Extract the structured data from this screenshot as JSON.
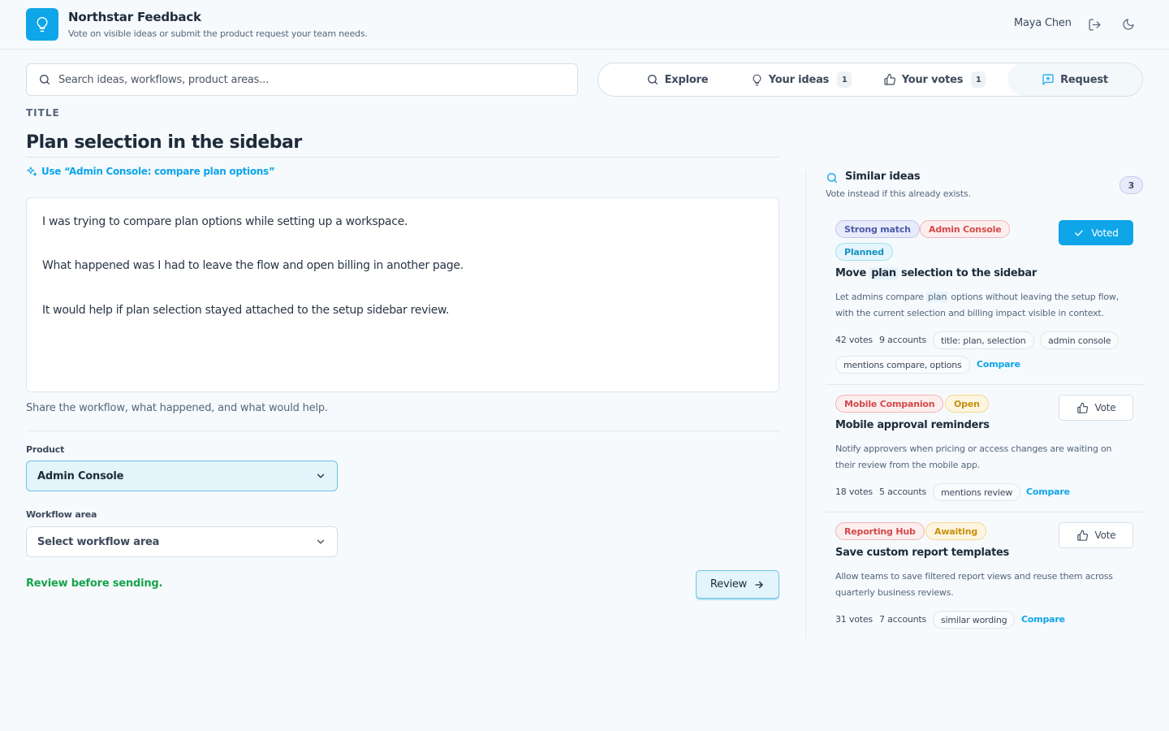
{
  "app": {
    "title": "Northstar Feedback",
    "subtitle": "Vote on visible ideas or submit the product request your team needs.",
    "user_name": "Maya Chen",
    "icons": [
      "lightbulb-icon",
      "logout-icon",
      "moon-icon"
    ]
  },
  "search": {
    "placeholder": "Search ideas, workflows, product areas...",
    "value": ""
  },
  "nav": {
    "explore": "Explore",
    "your_ideas": "Your ideas",
    "your_ideas_count": "1",
    "your_votes": "Your votes",
    "your_votes_count": "1",
    "request": "Request",
    "active": "request"
  },
  "form": {
    "title_label": "TITLE",
    "title_value": "Plan selection in the sidebar",
    "suggestion": "Use “Admin Console: compare plan options”",
    "description_lines": [
      "I was trying to compare plan options while setting up a workspace.",
      "What happened was I had to leave the flow and open billing in another page.",
      "It would help if plan selection stayed attached to the setup sidebar review."
    ],
    "hint": "Share the workflow, what happened, and what would help.",
    "product_label": "Product",
    "product_value": "Admin Console",
    "workflow_label": "Workflow area",
    "workflow_placeholder": "Select workflow area",
    "review_note": "Review before sending.",
    "review_button": "Review"
  },
  "similar": {
    "title": "Similar ideas",
    "subtitle": "Vote instead if this already exists.",
    "count": "3",
    "ideas": [
      {
        "tags": [
          "Strong match",
          "Admin Console",
          "Planned"
        ],
        "title_parts": [
          "Move ",
          "plan",
          " selection to the sidebar"
        ],
        "desc_parts": [
          "Let admins compare ",
          "plan",
          " options without leaving the setup flow, with the current selection and billing impact visible in context."
        ],
        "votes": "42 votes",
        "accounts": "9 accounts",
        "chips": [
          "title: plan, selection",
          "admin console",
          "mentions compare, options"
        ],
        "compare": "Compare",
        "vote_label": "Voted",
        "voted": true
      },
      {
        "tags": [
          "Mobile Companion",
          "Open"
        ],
        "title": "Mobile approval reminders",
        "desc": "Notify approvers when pricing or access changes are waiting on their review from the mobile app.",
        "votes": "18 votes",
        "accounts": "5 accounts",
        "chips": [
          "mentions review"
        ],
        "compare": "Compare",
        "vote_label": "Vote",
        "voted": false
      },
      {
        "tags": [
          "Reporting Hub",
          "Awaiting"
        ],
        "title": "Save custom report templates",
        "desc": "Allow teams to save filtered report views and reuse them across quarterly business reviews.",
        "votes": "31 votes",
        "accounts": "7 accounts",
        "chips": [
          "similar wording"
        ],
        "compare": "Compare",
        "vote_label": "Vote",
        "voted": false
      }
    ]
  },
  "colors": {
    "accent": "#0ea5e9",
    "success": "#16a34a",
    "background": "#f6fafd"
  }
}
